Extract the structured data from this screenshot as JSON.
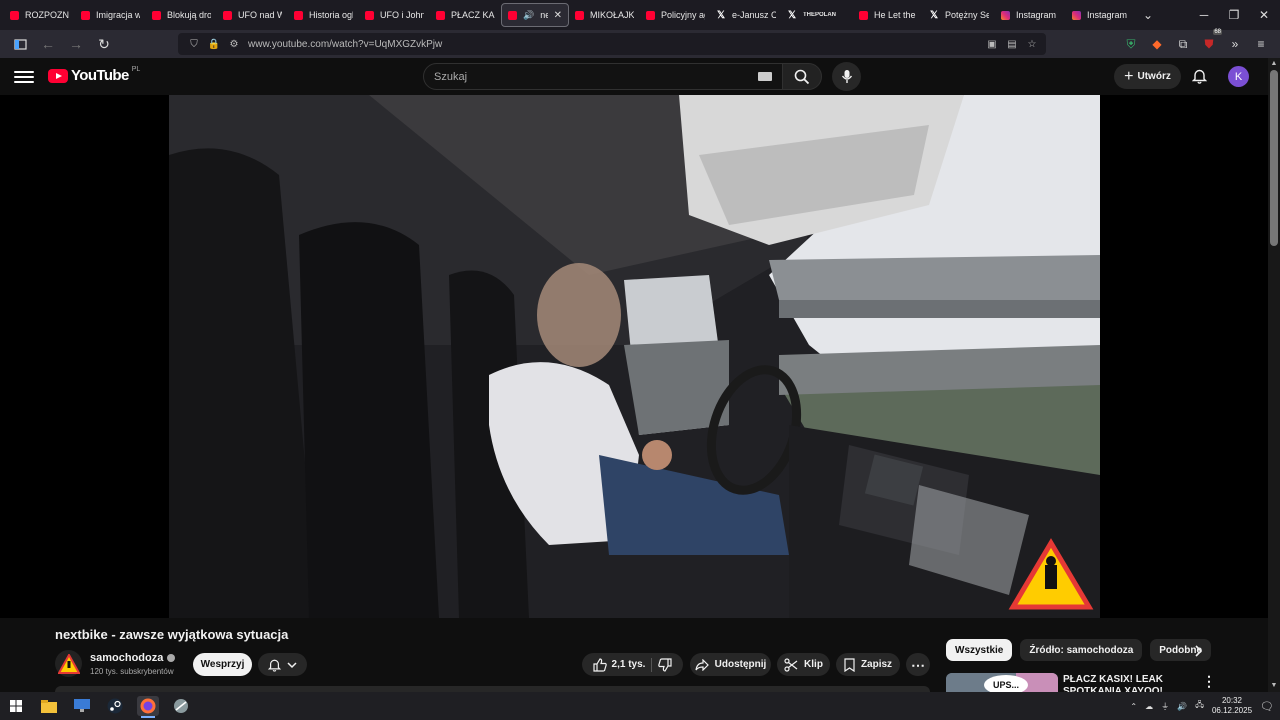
{
  "browser": {
    "tabs": [
      {
        "label": "ROZPOZNA",
        "favicon": "youtube"
      },
      {
        "label": "Imigracja w",
        "favicon": "youtube"
      },
      {
        "label": "Blokują dro",
        "favicon": "youtube"
      },
      {
        "label": "UFO nad W",
        "favicon": "youtube"
      },
      {
        "label": "Historia ogl",
        "favicon": "youtube"
      },
      {
        "label": "UFO i John",
        "favicon": "youtube"
      },
      {
        "label": "PŁACZ KASI",
        "favicon": "youtube"
      },
      {
        "label": "next",
        "favicon": "youtube",
        "active": true
      },
      {
        "label": "MIKOŁAJKI",
        "favicon": "youtube"
      },
      {
        "label": "Policyjny ag",
        "favicon": "youtube"
      },
      {
        "label": "e-Janusz Ch",
        "favicon": "x"
      },
      {
        "label": "THEPOLAN",
        "favicon": "x"
      },
      {
        "label": "He Let the I",
        "favicon": "youtube"
      },
      {
        "label": "Potężny Set",
        "favicon": "x"
      },
      {
        "label": "Instagram",
        "favicon": "instagram"
      },
      {
        "label": "Instagram",
        "favicon": "instagram"
      }
    ],
    "url": "www.youtube.com/watch?v=UqMXGZvkPjw",
    "extension_badge": "68"
  },
  "youtube": {
    "logo_text": "YouTube",
    "region": "PL",
    "search_placeholder": "Szukaj",
    "create_label": "Utwórz",
    "avatar_letter": "K"
  },
  "video": {
    "title": "nextbike - zawsze wyjątkowa sytuacja",
    "channel_name": "samochodoza",
    "subscribers": "120 tys. subskrybentów",
    "support_label": "Wesprzyj",
    "likes": "2,1 tys.",
    "share_label": "Udostępnij",
    "clip_label": "Klip",
    "save_label": "Zapisz"
  },
  "sidebar": {
    "chips": [
      "Wszystkie",
      "Źródło: samochodoza",
      "Podobne"
    ],
    "recommended": {
      "thumb_text": "UPS...",
      "title": "PŁACZ KASIX! LEAK SPOTKANIA XAYOO!"
    }
  },
  "taskbar": {
    "time": "20:32",
    "date": "06.12.2025"
  },
  "colors": {
    "accent_red": "#ff0033",
    "background": "#0f0f0f",
    "avatar": "#7b4fd4"
  }
}
